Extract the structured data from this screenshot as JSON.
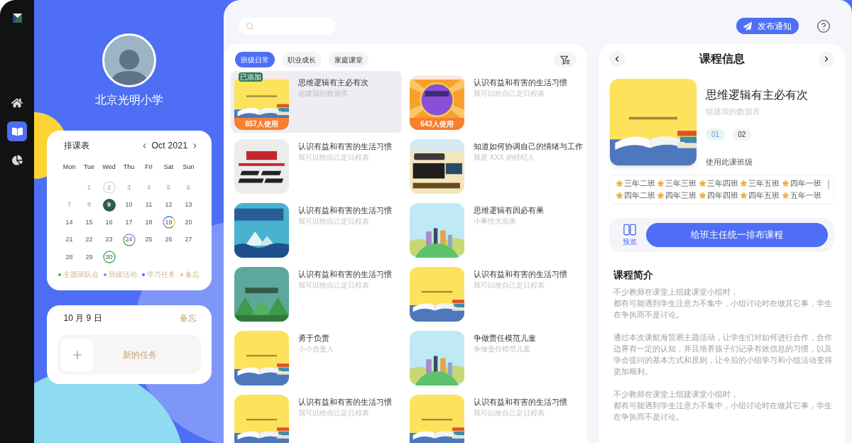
{
  "sidebar": {
    "items": [
      {
        "kind": "home",
        "selected": false
      },
      {
        "kind": "book",
        "selected": true
      },
      {
        "kind": "chart",
        "selected": false
      }
    ]
  },
  "profile": {
    "name": "北京光明小学"
  },
  "calendar": {
    "title": "排课表",
    "month": "Oct 2021",
    "weekdays": [
      "Mon",
      "Tue",
      "Wed",
      "Thu",
      "Fri",
      "Sat",
      "Sun"
    ],
    "weeks": [
      {
        "days": [
          {
            "label": "1",
            "muted": true,
            "selected": false
          },
          {
            "label": "2",
            "muted": true,
            "selected": false,
            "events": [
              {
                "color": "#dddddd"
              }
            ]
          },
          {
            "label": "3",
            "muted": true,
            "selected": false
          },
          {
            "label": "4",
            "muted": true,
            "selected": false
          },
          {
            "label": "5",
            "muted": true,
            "selected": false
          },
          {
            "label": "6",
            "muted": true,
            "selected": false
          }
        ]
      },
      {
        "days": [
          {
            "label": "7",
            "muted": true,
            "selected": false
          },
          {
            "label": "8",
            "muted": true,
            "selected": false
          },
          {
            "label": "9",
            "muted": false,
            "selected": true
          },
          {
            "label": "10",
            "muted": false,
            "selected": false
          },
          {
            "label": "11",
            "muted": false,
            "selected": false
          },
          {
            "label": "12",
            "muted": false,
            "selected": false
          },
          {
            "label": "13",
            "muted": false,
            "selected": false
          }
        ]
      },
      {
        "days": [
          {
            "label": "14",
            "muted": false,
            "selected": false
          },
          {
            "label": "15",
            "muted": false,
            "selected": false
          },
          {
            "label": "16",
            "muted": false,
            "selected": false
          },
          {
            "label": "17",
            "muted": false,
            "selected": false
          },
          {
            "label": "18",
            "muted": false,
            "selected": false
          },
          {
            "label": "19",
            "muted": false,
            "selected": false,
            "events": [
              {
                "color": "#4d6ef5"
              },
              {
                "color": "#f7c948"
              },
              {
                "color": "#4caf50"
              },
              {
                "color": "#a77be8"
              }
            ]
          },
          {
            "label": "20",
            "muted": false,
            "selected": false
          }
        ]
      },
      {
        "days": [
          {
            "label": "21",
            "muted": false,
            "selected": false
          },
          {
            "label": "22",
            "muted": false,
            "selected": false
          },
          {
            "label": "23",
            "muted": false,
            "selected": false
          },
          {
            "label": "24",
            "muted": false,
            "selected": false,
            "events": [
              {
                "color": "#a77be8"
              },
              {
                "color": "#4caf50"
              }
            ]
          },
          {
            "label": "25",
            "muted": false,
            "selected": false
          },
          {
            "label": "26",
            "muted": false,
            "selected": false
          },
          {
            "label": "27",
            "muted": false,
            "selected": false
          }
        ]
      },
      {
        "days": [
          {
            "label": "28",
            "muted": false,
            "selected": false
          },
          {
            "label": "29",
            "muted": false,
            "selected": false
          },
          {
            "label": "30",
            "muted": false,
            "selected": false,
            "events": [
              {
                "color": "#4caf50"
              }
            ]
          }
        ]
      }
    ],
    "legend": [
      {
        "label": "主题班队会",
        "color": "#4caf50"
      },
      {
        "label": "班级活动",
        "color": "#a77be8"
      },
      {
        "label": "学习任务",
        "color": "#4d6ef5"
      },
      {
        "label": "备忘",
        "color": "#f7c948"
      }
    ]
  },
  "memo": {
    "date": "10 月 9 日",
    "link": "备忘",
    "new_task": "新的任务"
  },
  "top_bar": {
    "publish_button": "发布通知"
  },
  "course_tabs": [
    {
      "label": "班级日常",
      "selected": true
    },
    {
      "label": "职业成长",
      "selected": false
    },
    {
      "label": "家庭课堂",
      "selected": false
    }
  ],
  "courses": [
    {
      "kind": "book",
      "selected": true,
      "tag": "已添加",
      "usage": "857人使用",
      "title": "思维逻辑有主必有次",
      "subtitle": "组建我的数据库"
    },
    {
      "kind": "burst",
      "selected": false,
      "usage": "643人使用",
      "title": "认识有益和有害的生活习惯",
      "subtitle": "我可以给自己定日程表"
    },
    {
      "kind": "poster",
      "selected": false,
      "title": "认识有益和有害的生活习惯",
      "subtitle": "我可以给自己定日程表"
    },
    {
      "kind": "comic",
      "selected": false,
      "title": "知道如何协调自己的情绪与工作",
      "subtitle": "我是 XXX 的经纪人"
    },
    {
      "kind": "sea",
      "selected": false,
      "title": "认识有益和有害的生活习惯",
      "subtitle": "我可以给自己定日程表"
    },
    {
      "kind": "city",
      "selected": false,
      "title": "思维逻辑有因必有果",
      "subtitle": "小事情大后果"
    },
    {
      "kind": "forest",
      "selected": false,
      "title": "认识有益和有害的生活习惯",
      "subtitle": "我可以给自己定日程表"
    },
    {
      "kind": "book",
      "selected": false,
      "title": "认识有益和有害的生活习惯",
      "subtitle": "我可以给自己定日程表"
    },
    {
      "kind": "book",
      "selected": false,
      "title": "勇于负责",
      "subtitle": "小小负责人"
    },
    {
      "kind": "city",
      "selected": false,
      "title": "争做责任模范儿童",
      "subtitle": "争做责任模范儿童"
    },
    {
      "kind": "book",
      "selected": false,
      "title": "认识有益和有害的生活习惯",
      "subtitle": "我可以给自己定日程表"
    },
    {
      "kind": "book",
      "selected": false,
      "title": "认识有益和有害的生活习惯",
      "subtitle": "我可以给自己定日程表"
    }
  ],
  "detail": {
    "title": "课程信息",
    "cover": {
      "kind": "book"
    },
    "course_title": "思维逻辑有主必有次",
    "course_subtitle": "组建我的数据库",
    "versions": [
      {
        "label": "01",
        "selected": true
      },
      {
        "label": "02",
        "selected": false
      }
    ],
    "classes_label": "使用此课班级",
    "classes": [
      "三年二班",
      "三年三班",
      "三年四班",
      "三年五班",
      "四年一班",
      "四年二班",
      "四年三班",
      "四年四班",
      "四年五班",
      "五年一班"
    ],
    "preview": "预览",
    "assign_button": "给班主任统一排布课程",
    "intro_title": "课程简介",
    "intro": [
      {
        "lines": [
          "不少教师在课堂上组建课堂小组时，",
          "都有可能遇到学生注意力不集中，小组讨论时在做其它事，学生在争执而不是讨论。"
        ]
      },
      {
        "lines": [
          "通过本次课航海贸易主题活动，让学生们对如何进行合作，合作边界有一定的认知，并且培养孩子们记录有效信息的习惯，以及学会提问的基本方式和原则，让今后的小组学习和小组活动变得更加顺利。"
        ]
      },
      {
        "lines": [
          "不少教师在课堂上组建课堂小组时，",
          "都有可能遇到学生注意力不集中，小组讨论时在做其它事，学生在争执而不是讨论。"
        ]
      }
    ]
  }
}
